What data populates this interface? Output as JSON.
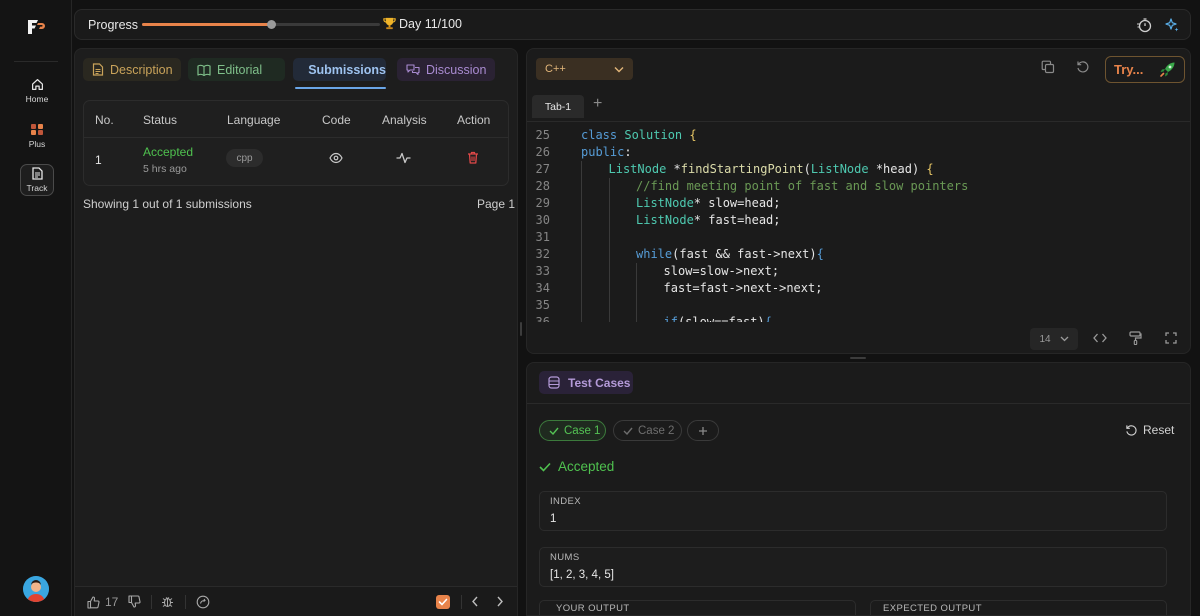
{
  "sidebar": {
    "items": [
      {
        "label": "Home"
      },
      {
        "label": "Plus"
      },
      {
        "label": "Track"
      }
    ]
  },
  "topbar": {
    "progress_label": "Progress",
    "progress_value": 0.54,
    "day_text": "Day 11/100"
  },
  "left_tabs": {
    "description": "Description",
    "editorial": "Editorial",
    "submissions": "Submissions",
    "discussion": "Discussion"
  },
  "submissions_table": {
    "headers": [
      "No.",
      "Status",
      "Language",
      "Code",
      "Analysis",
      "Action"
    ],
    "rows": [
      {
        "no": "1",
        "status": "Accepted",
        "time_ago": "5 hrs ago",
        "language": "cpp"
      }
    ],
    "showing_text": "Showing 1 out of 1 submissions",
    "page_text": "Page 1"
  },
  "left_footer": {
    "likes": "17"
  },
  "editor": {
    "language": "C++",
    "try_label": "Try...",
    "file_tab": "Tab-1",
    "font_size": "14",
    "code_lines": [
      {
        "n": "25",
        "indent": 0,
        "html": "<span class=\"k\">class</span> <span class=\"t\">Solution</span> <span class=\"p\">{</span>"
      },
      {
        "n": "26",
        "indent": 0,
        "html": "<span class=\"k\">public</span>:"
      },
      {
        "n": "27",
        "indent": 1,
        "html": "<span class=\"t\">ListNode</span> *<span class=\"f\">findStartingPoint</span>(<span class=\"t\">ListNode</span> *head) <span class=\"p\">{</span>"
      },
      {
        "n": "28",
        "indent": 2,
        "html": "<span class=\"c\">//find meeting point of fast and slow pointers</span>"
      },
      {
        "n": "29",
        "indent": 2,
        "html": "<span class=\"t\">ListNode</span>* slow=head;"
      },
      {
        "n": "30",
        "indent": 2,
        "html": "<span class=\"t\">ListNode</span>* fast=head;"
      },
      {
        "n": "31",
        "indent": 2,
        "html": ""
      },
      {
        "n": "32",
        "indent": 2,
        "html": "<span class=\"k\">while</span>(fast &amp;&amp; fast-&gt;next)<span class=\"k\">{</span>"
      },
      {
        "n": "33",
        "indent": 3,
        "html": "slow=slow-&gt;next;"
      },
      {
        "n": "34",
        "indent": 3,
        "html": "fast=fast-&gt;next-&gt;next;"
      },
      {
        "n": "35",
        "indent": 3,
        "html": ""
      },
      {
        "n": "36",
        "indent": 3,
        "html": "<span class=\"k\">if</span>(slow==fast)<span class=\"k\">{</span>"
      }
    ]
  },
  "testcases": {
    "title": "Test Cases",
    "cases": [
      "Case 1",
      "Case 2"
    ],
    "reset_label": "Reset",
    "result": "Accepted",
    "fields": [
      {
        "label": "INDEX",
        "value": "1"
      },
      {
        "label": "NUMS",
        "value": "[1, 2, 3, 4, 5]"
      }
    ],
    "your_output_label": "YOUR OUTPUT",
    "expected_output_label": "EXPECTED OUTPUT"
  },
  "colors": {
    "accent": "#e8834a",
    "accepted": "#4fc14f",
    "delete": "#e04848",
    "submissions_tab": "#9ec3ef"
  }
}
